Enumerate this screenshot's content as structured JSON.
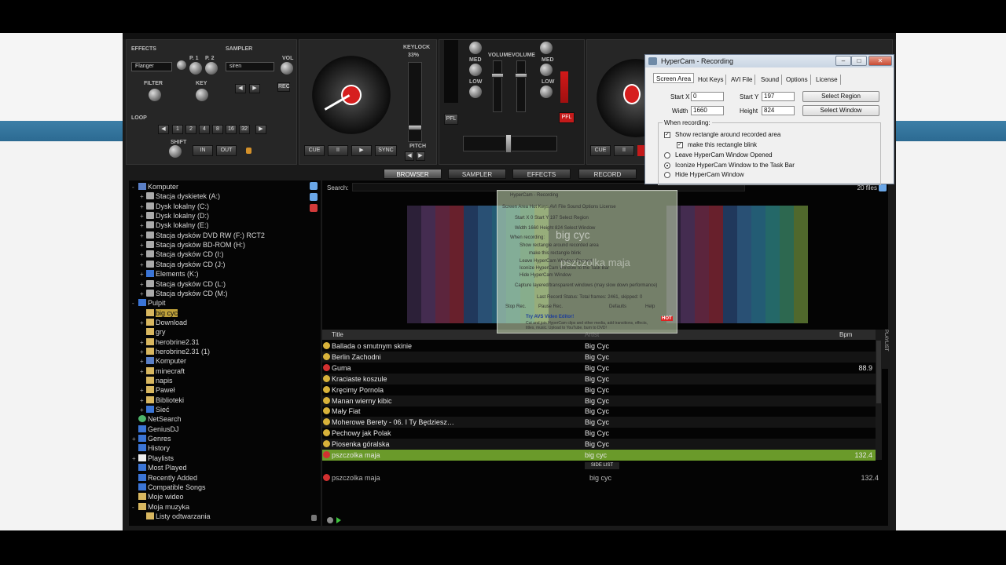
{
  "effects_panel": {
    "effects_label": "EFFECTS",
    "effect_selected": "Flanger",
    "p1": "P. 1",
    "p2": "P. 2",
    "sampler_label": "SAMPLER",
    "sampler_selected": "siren",
    "vol": "VOL",
    "filter": "FILTER",
    "key": "KEY",
    "rec": "REC",
    "loop_label": "LOOP",
    "loop_values": [
      "1",
      "2",
      "4",
      "8",
      "16",
      "32"
    ],
    "shift": "SHIFT",
    "in": "IN",
    "out": "OUT"
  },
  "deck": {
    "keylock": "KEYLOCK",
    "pitch_pct": "33%",
    "cue": "CUE",
    "pause": "II",
    "play": "▶",
    "sync": "SYNC",
    "pitch": "PITCH"
  },
  "mixer": {
    "med": "MED",
    "low": "LOW",
    "volume": "VOLUME",
    "pfl": "PFL"
  },
  "tabs": [
    "BROWSER",
    "SAMPLER",
    "EFFECTS",
    "RECORD"
  ],
  "tree": [
    {
      "label": "Komputer",
      "icon": "pc",
      "exp": "-"
    },
    {
      "label": "Stacja dyskietek (A:)",
      "icon": "drive",
      "exp": "+"
    },
    {
      "label": "Dysk lokalny (C:)",
      "icon": "drive",
      "exp": "+"
    },
    {
      "label": "Dysk lokalny (D:)",
      "icon": "drive",
      "exp": "+"
    },
    {
      "label": "Dysk lokalny (E:)",
      "icon": "drive",
      "exp": "+"
    },
    {
      "label": "Stacja dysków DVD RW (F:) RCT2",
      "icon": "drive",
      "exp": "+"
    },
    {
      "label": "Stacja dysków BD-ROM (H:)",
      "icon": "drive",
      "exp": "+"
    },
    {
      "label": "Stacja dysków CD (I:)",
      "icon": "drive",
      "exp": "+"
    },
    {
      "label": "Stacja dysków CD (J:)",
      "icon": "drive",
      "exp": "+"
    },
    {
      "label": "Elements (K:)",
      "icon": "blue",
      "exp": "+"
    },
    {
      "label": "Stacja dysków CD (L:)",
      "icon": "drive",
      "exp": "+"
    },
    {
      "label": "Stacja dysków CD (M:)",
      "icon": "drive",
      "exp": "+"
    },
    {
      "label": "Pulpit",
      "icon": "blue",
      "exp": "-"
    },
    {
      "label": "big cyc",
      "icon": "folder",
      "exp": ""
    },
    {
      "label": "Download",
      "icon": "folder",
      "exp": "+"
    },
    {
      "label": "gry",
      "icon": "folder",
      "exp": ""
    },
    {
      "label": "herobrine2.31",
      "icon": "folder",
      "exp": "+"
    },
    {
      "label": "herobrine2.31 (1)",
      "icon": "folder",
      "exp": "+"
    },
    {
      "label": "Komputer",
      "icon": "pc",
      "exp": "+"
    },
    {
      "label": "minecraft",
      "icon": "folder",
      "exp": "+"
    },
    {
      "label": "napis",
      "icon": "folder",
      "exp": ""
    },
    {
      "label": "Paweł",
      "icon": "folder",
      "exp": "+"
    },
    {
      "label": "Biblioteki",
      "icon": "folder",
      "exp": "+"
    },
    {
      "label": "Sieć",
      "icon": "blue",
      "exp": "+"
    },
    {
      "label": "NetSearch",
      "icon": "green",
      "exp": ""
    },
    {
      "label": "GeniusDJ",
      "icon": "blue",
      "exp": ""
    },
    {
      "label": "Genres",
      "icon": "blue",
      "exp": "+"
    },
    {
      "label": "History",
      "icon": "blue",
      "exp": ""
    },
    {
      "label": "Playlists",
      "icon": "page",
      "exp": "+"
    },
    {
      "label": "Most Played",
      "icon": "blue",
      "exp": ""
    },
    {
      "label": "Recently Added",
      "icon": "blue",
      "exp": ""
    },
    {
      "label": "Compatible Songs",
      "icon": "blue",
      "exp": ""
    },
    {
      "label": "Moje wideo",
      "icon": "folder",
      "exp": ""
    },
    {
      "label": "Moja muzyka",
      "icon": "folder",
      "exp": "-"
    },
    {
      "label": "Listy odtwarzania",
      "icon": "folder",
      "exp": ""
    }
  ],
  "browser": {
    "search_label": "Search:",
    "files_count": "20 files",
    "columns": {
      "title": "Title",
      "artist": "Artist",
      "bpm": "Bpm"
    },
    "playlist_tab": "PLAYLIST",
    "tracks": [
      {
        "title": "Ballada o smutnym skinie",
        "artist": "Big Cyc",
        "bpm": "",
        "icon": "yellow"
      },
      {
        "title": "Berlin Zachodni",
        "artist": "Big Cyc",
        "bpm": "",
        "icon": "yellow"
      },
      {
        "title": "Guma",
        "artist": "Big Cyc",
        "bpm": "88.9",
        "icon": "red"
      },
      {
        "title": "Kraciaste koszule",
        "artist": "Big Cyc",
        "bpm": "",
        "icon": "yellow"
      },
      {
        "title": "Kręcimy Pornola",
        "artist": "Big Cyc",
        "bpm": "",
        "icon": "yellow"
      },
      {
        "title": "Manan wierny kibic",
        "artist": "Big Cyc",
        "bpm": "",
        "icon": "yellow"
      },
      {
        "title": "Mały Fiat",
        "artist": "Big Cyc",
        "bpm": "",
        "icon": "yellow"
      },
      {
        "title": "Moherowe Berety - 06. I Ty Będziesz…",
        "artist": "Big Cyc",
        "bpm": "",
        "icon": "yellow"
      },
      {
        "title": "Pechowy jak Polak",
        "artist": "Big Cyc",
        "bpm": "",
        "icon": "yellow"
      },
      {
        "title": "Piosenka góralska",
        "artist": "Big Cyc",
        "bpm": "",
        "icon": "yellow"
      },
      {
        "title": "pszczolka maja",
        "artist": "big cyc",
        "bpm": "132.4",
        "icon": "red",
        "selected": true
      }
    ],
    "side_list_label": "SIDE LIST",
    "side_list": [
      {
        "title": "pszczolka maja",
        "artist": "big cyc",
        "bpm": "132.4"
      }
    ]
  },
  "hypercam": {
    "title": "HyperCam - Recording",
    "tabs": [
      "Screen Area",
      "Hot Keys",
      "AVI File",
      "Sound",
      "Options",
      "License"
    ],
    "start_x_label": "Start X",
    "start_x": "0",
    "start_y_label": "Start Y",
    "start_y": "197",
    "width_label": "Width",
    "width": "1660",
    "height_label": "Height",
    "height": "824",
    "select_region": "Select Region",
    "select_window": "Select Window",
    "when_recording": "When recording:",
    "opt_show_rect": "Show rectangle around recorded area",
    "opt_blink": "make this rectangle blink",
    "opt_leave": "Leave HyperCam Window Opened",
    "opt_iconize": "Iconize HyperCam Window to the Task Bar",
    "opt_hide": "Hide HyperCam Window",
    "min": "–",
    "max": "□",
    "close": "✕"
  },
  "ghost": {
    "title": "HyperCam - Recording",
    "tabs": "Screen Area   Hot Keys   AVI File   Sound   Options   License",
    "row1": "Start X  0        Start Y  197       Select Region",
    "row2": "Width  1660       Height  824       Select Window",
    "when": "When recording:",
    "l1": "Show rectangle around recorded area",
    "l2": "make this rectangle blink",
    "l3": "Leave HyperCam Window Opened",
    "l4": "Iconize HyperCam Window to the Task Bar",
    "l5": "Hide HyperCam Window",
    "l6": "Capture layered/transparent windows (may slow down performance)",
    "status": "Last Record Status: Total frames: 2461, skipped: 0",
    "b1": "Stop Rec.",
    "b2": "Pause Rec.",
    "b3": "Defaults",
    "b4": "Help",
    "promo_title": "Try AVS Video Editor!",
    "promo_text": "Cut and join HyperCam clips and other media, add transitions, effects, titles, music. Upload to YouTube, burn to DVD!",
    "hot": "HOT",
    "big1": "big cyc",
    "big2": "pszczolka maja"
  },
  "cover_colors": [
    "#3a2a4a",
    "#5a3a6a",
    "#7a3050",
    "#8a2a3a",
    "#2a4a7a",
    "#356a9a",
    "#2e7a9a",
    "#2f8a8a",
    "#3b8a6a",
    "#6a8a3a"
  ]
}
